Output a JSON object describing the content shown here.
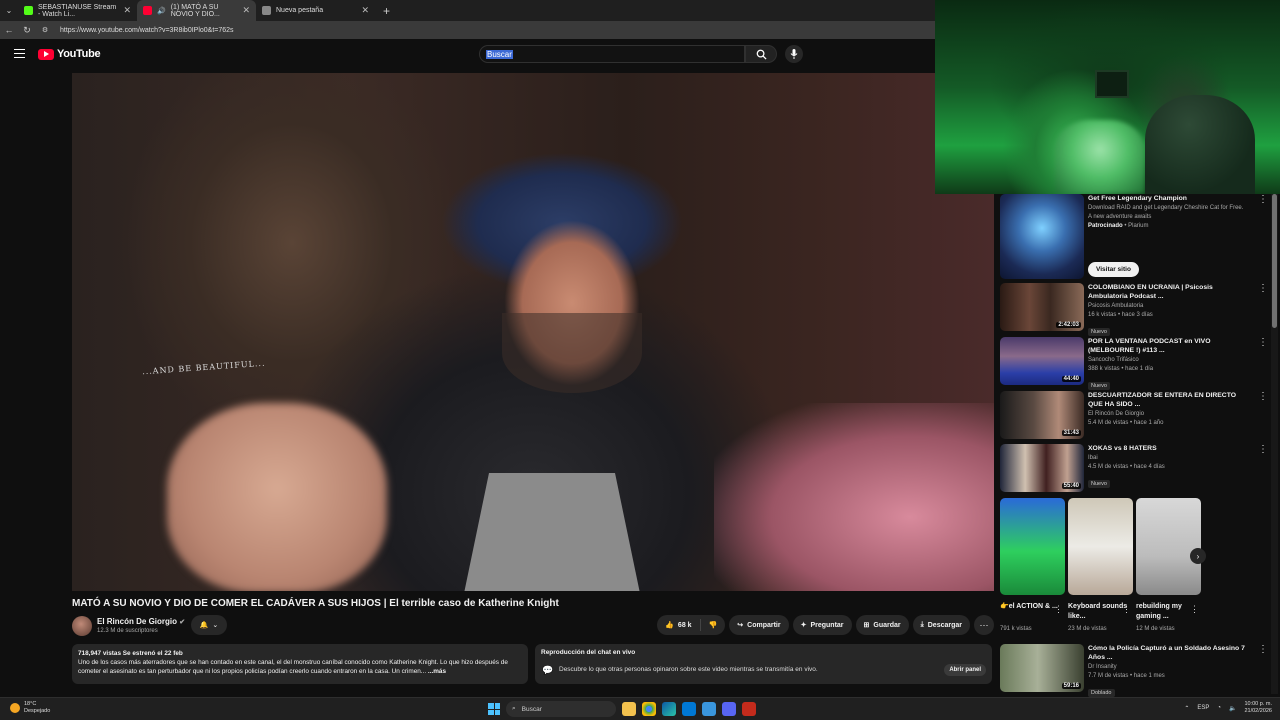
{
  "browser": {
    "tabs": [
      {
        "label": "SEBASTIANUSE Stream - Watch Li...",
        "fav_color": "#53fc18"
      },
      {
        "label": "(1) MATÓ A SU NOVIO Y DIO...",
        "fav_color": "#ff0033"
      },
      {
        "label": "Nueva pestaña",
        "fav_color": "#888888"
      }
    ],
    "url": "https://www.youtube.com/watch?v=3R8ib0IPlo0&t=762s"
  },
  "header": {
    "logo_text": "YouTube",
    "search_value": "Buscar"
  },
  "video": {
    "poster_text": "...AND BE BEAUTIFUL...",
    "title": "MATÓ A SU NOVIO Y DIO DE COMER EL CADÁVER A SUS HIJOS | El terrible caso de Katherine Knight",
    "channel": "El Rincón De Giorgio",
    "subscribers": "12.3 M de suscriptores",
    "likes": "68 k",
    "actions": {
      "share": "Compartir",
      "ask": "Preguntar",
      "save": "Guardar",
      "download": "Descargar"
    },
    "description": {
      "stats": "718,947 vistas  Se estrenó el 22 feb",
      "text": "Uno de los casos más aterradores que se han contado en este canal, el del monstruo caníbal conocido como Katherine Knight. Lo que hizo después de cometer el asesinato es tan perturbador que ni los propios policías podían creerlo cuando entraron en la casa. Un crimen...",
      "more": "...más"
    },
    "chat": {
      "heading": "Reproducción del chat en vivo",
      "text": "Descubre lo que otras personas opinaron sobre este video mientras se transmitía en vivo.",
      "open": "Abrir panel"
    }
  },
  "sidebar": {
    "ad": {
      "title": "Get Free Legendary Champion",
      "desc": "Download RAID and get Legendary Cheshire Cat for Free. A new adventure awaits",
      "sponsor": "Patrocinado",
      "advertiser": "Plarium",
      "cta": "Visitar sitio"
    },
    "items": [
      {
        "title": "COLOMBIANO EN UCRANIA | Psicosis Ambulatoria Podcast ...",
        "channel": "Psicosis Ambulatoria",
        "views": "16 k vistas • hace 3 días",
        "badge": "Nuevo",
        "duration": "2:42:03"
      },
      {
        "title": "POR LA VENTANA PODCAST en VIVO (MELBOURNE !) #113 ...",
        "channel": "Sancocho Trifásico",
        "views": "388 k vistas • hace 1 día",
        "badge": "Nuevo",
        "duration": "44:40"
      },
      {
        "title": "DESCUARTIZADOR SE ENTERA EN DIRECTO QUE HA SIDO ...",
        "channel": "El Rincón De Giorgio",
        "views": "5.4 M de vistas • hace 1 año",
        "badge": "",
        "duration": "31:43"
      },
      {
        "title": "XOKAS vs 8 HATERS",
        "channel": "Ibai",
        "views": "4.5 M de vistas • hace 4 días",
        "badge": "Nuevo",
        "duration": "55:40"
      }
    ],
    "shorts": [
      {
        "title": "👉el ACTION & ...",
        "views": "791 k vistas"
      },
      {
        "title": "Keyboard sounds like...",
        "views": "23 M de vistas"
      },
      {
        "title": "rebuilding my gaming ...",
        "views": "12 M de vistas"
      }
    ],
    "last": {
      "title": "Cómo la Policía Capturó a un Soldado Asesino 7 Años ...",
      "channel": "Dr Insanity",
      "views": "7.7 M de vistas • hace 1 mes",
      "badge": "Doblado",
      "duration": "59:16"
    }
  },
  "taskbar": {
    "temp": "18°C",
    "condition": "Despejado",
    "search": "Buscar",
    "lang": "ESP",
    "time": "10:00 p. m.",
    "date": "21/02/2026"
  }
}
